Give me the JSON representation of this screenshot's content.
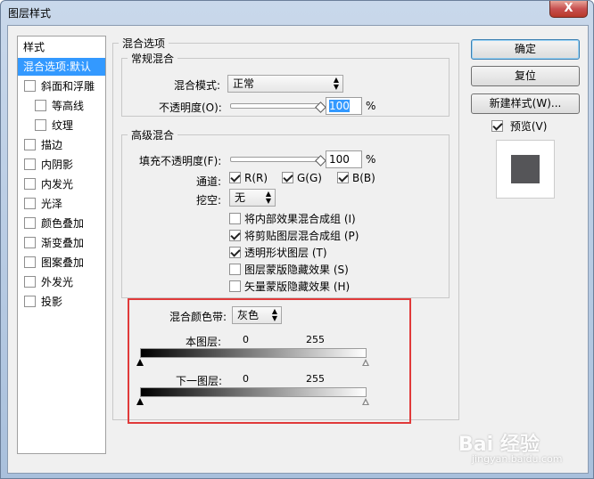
{
  "window": {
    "title": "图层样式",
    "close": "X"
  },
  "style_list": {
    "header": "样式",
    "items": [
      {
        "label": "混合选项:默认",
        "selected": true,
        "checkbox": false,
        "indent": false
      },
      {
        "label": "斜面和浮雕",
        "checked": false,
        "checkbox": true,
        "indent": false
      },
      {
        "label": "等高线",
        "checked": false,
        "checkbox": true,
        "indent": true
      },
      {
        "label": "纹理",
        "checked": false,
        "checkbox": true,
        "indent": true
      },
      {
        "label": "描边",
        "checked": false,
        "checkbox": true,
        "indent": false
      },
      {
        "label": "内阴影",
        "checked": false,
        "checkbox": true,
        "indent": false
      },
      {
        "label": "内发光",
        "checked": false,
        "checkbox": true,
        "indent": false
      },
      {
        "label": "光泽",
        "checked": false,
        "checkbox": true,
        "indent": false
      },
      {
        "label": "颜色叠加",
        "checked": false,
        "checkbox": true,
        "indent": false
      },
      {
        "label": "渐变叠加",
        "checked": false,
        "checkbox": true,
        "indent": false
      },
      {
        "label": "图案叠加",
        "checked": false,
        "checkbox": true,
        "indent": false
      },
      {
        "label": "外发光",
        "checked": false,
        "checkbox": true,
        "indent": false
      },
      {
        "label": "投影",
        "checked": false,
        "checkbox": true,
        "indent": false
      }
    ]
  },
  "blend": {
    "group_title": "混合选项",
    "general": {
      "title": "常规混合",
      "mode_label": "混合模式:",
      "mode_value": "正常",
      "opacity_label": "不透明度(O):",
      "opacity_value": "100",
      "opacity_unit": "%",
      "opacity_fraction": 1.0
    },
    "advanced": {
      "title": "高级混合",
      "fill_label": "填充不透明度(F):",
      "fill_value": "100",
      "fill_unit": "%",
      "fill_fraction": 1.0,
      "channels_label": "通道:",
      "channels": [
        {
          "label": "R(R)",
          "checked": true
        },
        {
          "label": "G(G)",
          "checked": true
        },
        {
          "label": "B(B)",
          "checked": true
        }
      ],
      "knockout_label": "挖空:",
      "knockout_value": "无",
      "options": [
        {
          "label": "将内部效果混合成组 (I)",
          "checked": false
        },
        {
          "label": "将剪贴图层混合成组 (P)",
          "checked": true
        },
        {
          "label": "透明形状图层 (T)",
          "checked": true
        },
        {
          "label": "图层蒙版隐藏效果 (S)",
          "checked": false
        },
        {
          "label": "矢量蒙版隐藏效果 (H)",
          "checked": false
        }
      ]
    },
    "blend_if": {
      "label": "混合颜色带:",
      "value": "灰色",
      "this_layer": {
        "label": "本图层:",
        "min": "0",
        "max": "255"
      },
      "underlying": {
        "label": "下一图层:",
        "min": "0",
        "max": "255"
      }
    }
  },
  "buttons": {
    "ok": "确定",
    "reset": "复位",
    "new_style": "新建样式(W)...",
    "preview_label": "预览(V)",
    "preview_checked": true
  },
  "watermark": {
    "main": "Bai 经验",
    "sub": "jingyan.baidu.com"
  },
  "colors": {
    "selection": "#3399ff",
    "highlight_box": "#e03a3a"
  }
}
